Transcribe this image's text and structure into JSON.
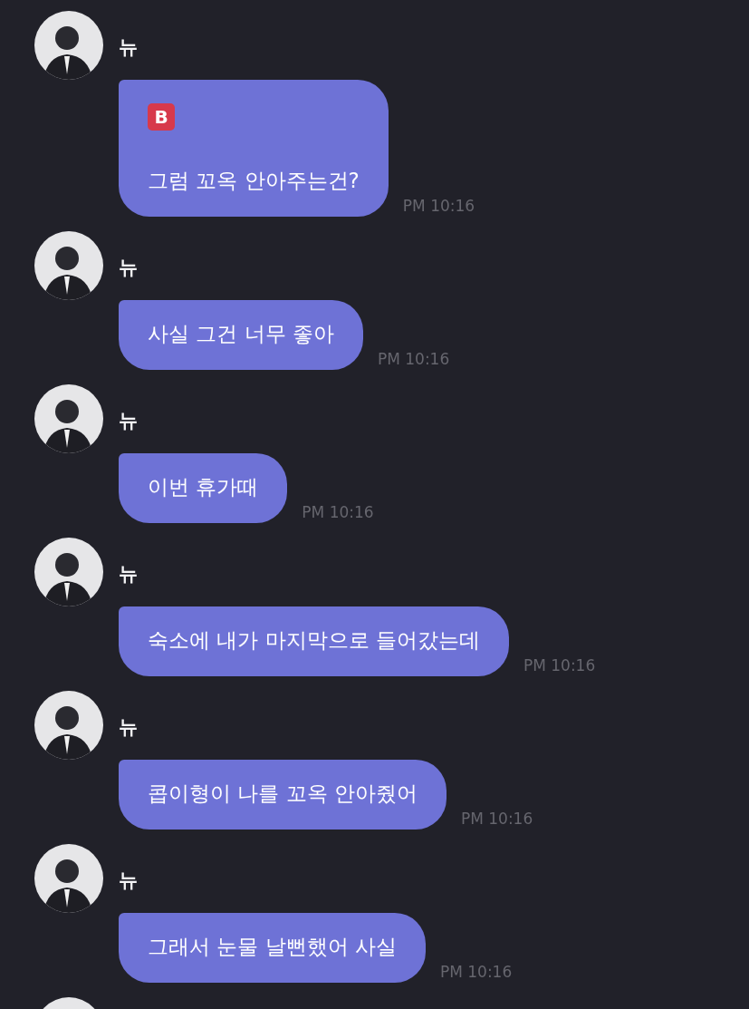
{
  "messages": [
    {
      "kind": "message",
      "sender": "뉴",
      "badge": "B",
      "text": "그럼 꼬옥 안아주는건?",
      "time": "PM 10:16"
    },
    {
      "kind": "message",
      "sender": "뉴",
      "text": "사실 그건 너무 좋아",
      "time": "PM 10:16"
    },
    {
      "kind": "message",
      "sender": "뉴",
      "text": "이번 휴가때",
      "time": "PM 10:16"
    },
    {
      "kind": "message",
      "sender": "뉴",
      "text": "숙소에 내가 마지막으로 들어갔는데",
      "time": "PM 10:16"
    },
    {
      "kind": "message",
      "sender": "뉴",
      "text": "콥이형이 나를 꼬옥 안아줬어",
      "time": "PM 10:16"
    },
    {
      "kind": "message",
      "sender": "뉴",
      "text": "그래서 눈물 날뻔했어 사실",
      "time": "PM 10:16"
    },
    {
      "kind": "avatar_only"
    }
  ]
}
